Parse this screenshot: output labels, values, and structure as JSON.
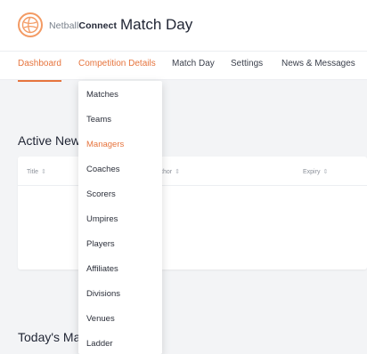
{
  "header": {
    "brand_light": "Netball",
    "brand_bold": "Connect",
    "title": "Match Day"
  },
  "nav": {
    "items": [
      {
        "label": "Dashboard",
        "state": "active"
      },
      {
        "label": "Competition Details",
        "state": "open"
      },
      {
        "label": "Match Day",
        "state": "normal"
      },
      {
        "label": "Settings",
        "state": "normal"
      },
      {
        "label": "News & Messages",
        "state": "normal"
      }
    ]
  },
  "dropdown": {
    "items": [
      {
        "label": "Matches"
      },
      {
        "label": "Teams"
      },
      {
        "label": "Managers",
        "selected": true
      },
      {
        "label": "Coaches"
      },
      {
        "label": "Scorers"
      },
      {
        "label": "Umpires"
      },
      {
        "label": "Players"
      },
      {
        "label": "Affiliates"
      },
      {
        "label": "Divisions"
      },
      {
        "label": "Venues"
      },
      {
        "label": "Ladder"
      }
    ]
  },
  "active_news": {
    "title": "Active New",
    "columns": [
      {
        "label": "Title",
        "sort_icon": "sort-icon"
      },
      {
        "label": "thor",
        "sort_icon": "sort-icon"
      },
      {
        "label": "Expiry",
        "sort_icon": "sort-icon"
      }
    ]
  },
  "todays_matches": {
    "title": "Today's Ma"
  },
  "colors": {
    "accent": "#e6743d",
    "logo_ring": "#f39a63",
    "background": "#f3f4f6"
  }
}
